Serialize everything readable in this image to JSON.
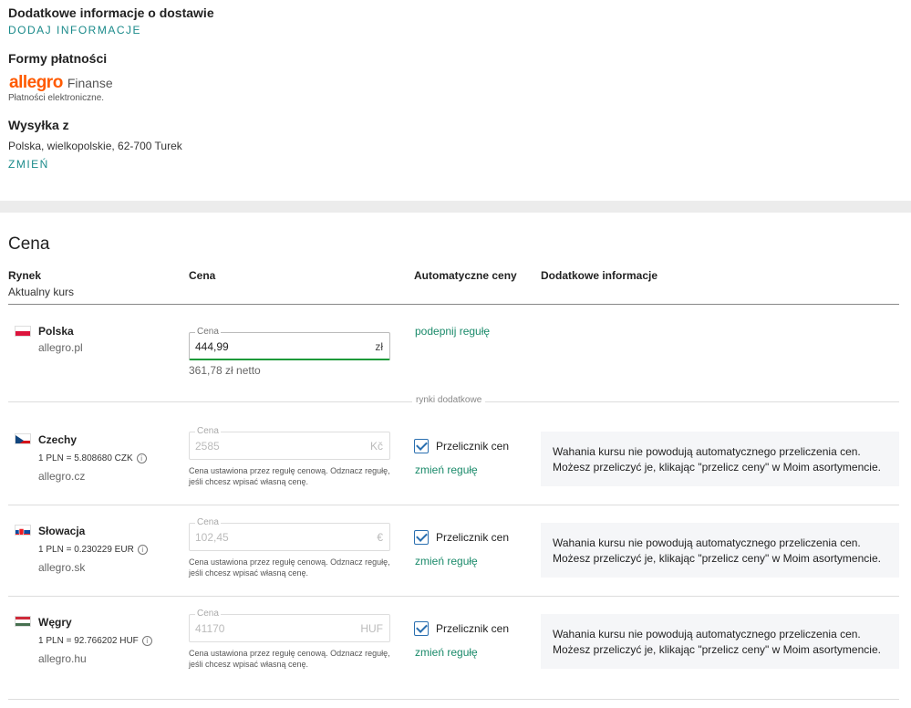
{
  "delivery": {
    "extra_info_title": "Dodatkowe informacje o dostawie",
    "add_info_link": "DODAJ INFORMACJE",
    "payment_title": "Formy płatności",
    "payment_brand": "allegro",
    "payment_brand_suffix": "Finanse",
    "payment_desc": "Płatności elektroniczne.",
    "ship_from_title": "Wysyłka z",
    "ship_from_address": "Polska, wielkopolskie, 62-700 Turek",
    "change_link": "ZMIEŃ"
  },
  "price": {
    "title": "Cena",
    "columns": {
      "market": "Rynek",
      "market_sub": "Aktualny kurs",
      "price": "Cena",
      "auto": "Automatyczne ceny",
      "extra": "Dodatkowe informacje"
    },
    "additional_markets_label": "rynki dodatkowe",
    "main": {
      "country": "Polska",
      "domain": "allegro.pl",
      "field_label": "Cena",
      "value": "444,99",
      "currency": "zł",
      "netto": "361,78 zł netto",
      "rule_link": "podepnij regułę"
    },
    "markets": [
      {
        "country": "Czechy",
        "rate": "1 PLN = 5.808680 CZK",
        "domain": "allegro.cz",
        "field_label": "Cena",
        "value": "2585",
        "currency": "Kč",
        "hint": "Cena ustawiona przez regułę cenową. Odznacz regułę, jeśli chcesz wpisać własną cenę.",
        "checkbox_label": "Przelicznik cen",
        "rule_link": "zmień regułę",
        "note": "Wahania kursu nie powodują automatycznego przeliczenia cen. Możesz przeliczyć je, klikając \"przelicz ceny\" w Moim asortymencie."
      },
      {
        "country": "Słowacja",
        "rate": "1 PLN = 0.230229 EUR",
        "domain": "allegro.sk",
        "field_label": "Cena",
        "value": "102,45",
        "currency": "€",
        "hint": "Cena ustawiona przez regułę cenową. Odznacz regułę, jeśli chcesz wpisać własną cenę.",
        "checkbox_label": "Przelicznik cen",
        "rule_link": "zmień regułę",
        "note": "Wahania kursu nie powodują automatycznego przeliczenia cen. Możesz przeliczyć je, klikając \"przelicz ceny\" w Moim asortymencie."
      },
      {
        "country": "Węgry",
        "rate": "1 PLN = 92.766202 HUF",
        "domain": "allegro.hu",
        "field_label": "Cena",
        "value": "41170",
        "currency": "HUF",
        "hint": "Cena ustawiona przez regułę cenową. Odznacz regułę, jeśli chcesz wpisać własną cenę.",
        "checkbox_label": "Przelicznik cen",
        "rule_link": "zmień regułę",
        "note": "Wahania kursu nie powodują automatycznego przeliczenia cen. Możesz przeliczyć je, klikając \"przelicz ceny\" w Moim asortymencie."
      }
    ]
  },
  "colors": {
    "accent_link": "#1a8a8a",
    "brand_orange": "#ff5a00",
    "active_border": "#1d9a3a",
    "checkbox": "#2a6fb0"
  }
}
